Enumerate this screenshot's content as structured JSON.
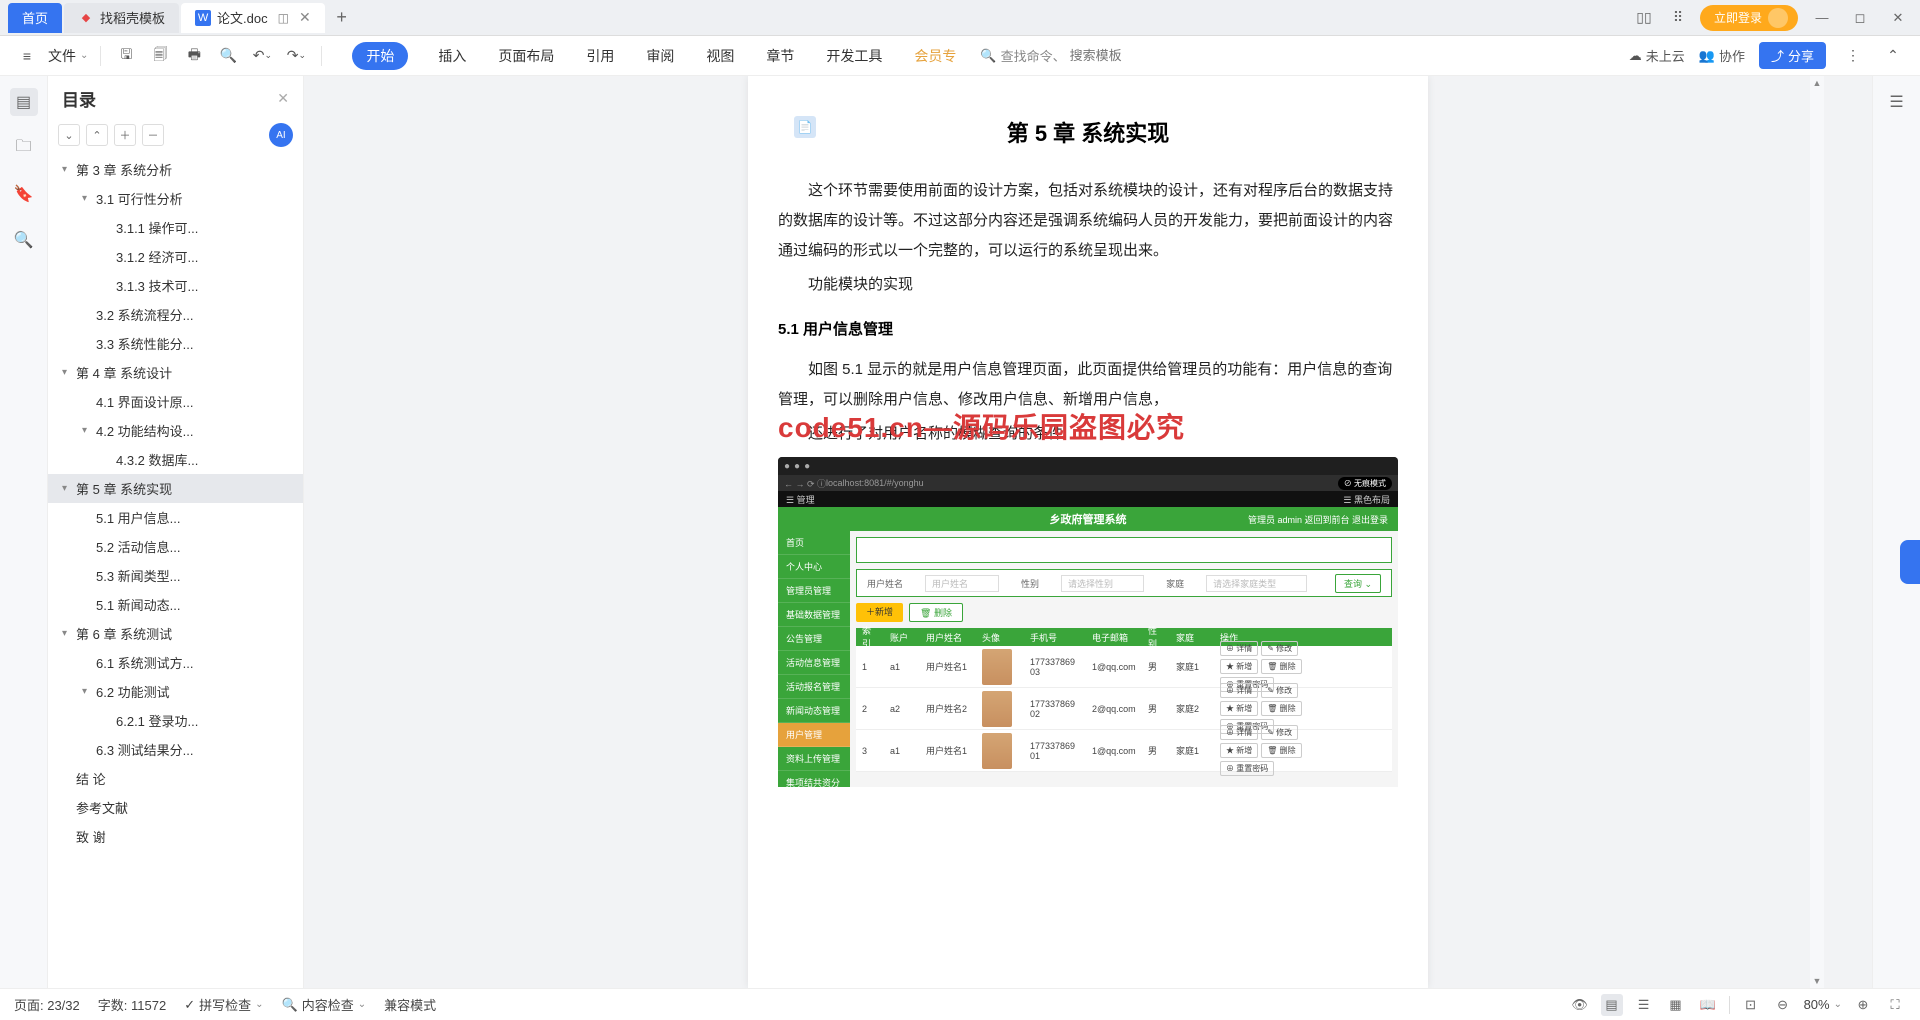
{
  "tabs": {
    "home": "首页",
    "tab1": "找稻壳模板",
    "tab2": "论文.doc",
    "add": "+"
  },
  "titlebar": {
    "login": "立即登录"
  },
  "ribbon": {
    "file": "文件",
    "menus": [
      "开始",
      "插入",
      "页面布局",
      "引用",
      "审阅",
      "视图",
      "章节",
      "开发工具",
      "会员专"
    ],
    "search_prefix": "查找命令、",
    "search_placeholder": "搜索模板",
    "cloud": "未上云",
    "coop": "协作",
    "share": "分享"
  },
  "outline": {
    "title": "目录",
    "items": [
      {
        "lvl": 1,
        "chev": "▾",
        "text": "第 3 章  系统分析"
      },
      {
        "lvl": 2,
        "chev": "▾",
        "text": "3.1 可行性分析"
      },
      {
        "lvl": 3,
        "chev": "",
        "text": "3.1.1 操作可..."
      },
      {
        "lvl": 3,
        "chev": "",
        "text": "3.1.2 经济可..."
      },
      {
        "lvl": 3,
        "chev": "",
        "text": "3.1.3 技术可..."
      },
      {
        "lvl": 2,
        "chev": "",
        "text": "3.2 系统流程分..."
      },
      {
        "lvl": 2,
        "chev": "",
        "text": "3.3 系统性能分..."
      },
      {
        "lvl": 1,
        "chev": "▾",
        "text": "第 4 章  系统设计"
      },
      {
        "lvl": 2,
        "chev": "",
        "text": "4.1 界面设计原..."
      },
      {
        "lvl": 2,
        "chev": "▾",
        "text": "4.2 功能结构设..."
      },
      {
        "lvl": 3,
        "chev": "",
        "text": "4.3.2 数据库..."
      },
      {
        "lvl": 1,
        "chev": "▾",
        "text": "第 5 章  系统实现",
        "sel": true
      },
      {
        "lvl": 2,
        "chev": "",
        "text": "5.1 用户信息..."
      },
      {
        "lvl": 2,
        "chev": "",
        "text": "5.2 活动信息..."
      },
      {
        "lvl": 2,
        "chev": "",
        "text": "5.3 新闻类型..."
      },
      {
        "lvl": 2,
        "chev": "",
        "text": "5.1 新闻动态..."
      },
      {
        "lvl": 1,
        "chev": "▾",
        "text": "第 6 章  系统测试"
      },
      {
        "lvl": 2,
        "chev": "",
        "text": "6.1 系统测试方..."
      },
      {
        "lvl": 2,
        "chev": "▾",
        "text": "6.2 功能测试"
      },
      {
        "lvl": 3,
        "chev": "",
        "text": "6.2.1 登录功..."
      },
      {
        "lvl": 2,
        "chev": "",
        "text": "6.3 测试结果分..."
      },
      {
        "lvl": 1,
        "chev": "",
        "text": "结   论"
      },
      {
        "lvl": 1,
        "chev": "",
        "text": "参考文献"
      },
      {
        "lvl": 1,
        "chev": "",
        "text": "致   谢"
      }
    ]
  },
  "document": {
    "title": "第 5 章  系统实现",
    "p1": "这个环节需要使用前面的设计方案，包括对系统模块的设计，还有对程序后台的数据支持的数据库的设计等。不过这部分内容还是强调系统编码人员的开发能力，要把前面设计的内容通过编码的形式以一个完整的，可以运行的系统呈现出来。",
    "p2": "功能模块的实现",
    "h3": "5.1 用户信息管理",
    "p3": "如图 5.1 显示的就是用户信息管理页面，此页面提供给管理员的功能有：用户信息的查询管理，可以删除用户信息、修改用户信息、新增用户信息，",
    "p4": "还进行了对用户名称的模糊查询的条件",
    "watermark": "code51.cn—源码乐园盗图必究"
  },
  "embed": {
    "url": "localhost:8081/#/yonghu",
    "mode": "⊘ 无痕模式",
    "topbar_left": "☰ 管理",
    "topbar_right": "☰ 黑色布局",
    "title": "乡政府管理系统",
    "header_right": "管理员 admin    返回到前台    退出登录",
    "side": [
      "首页",
      "个人中心",
      "管理员管理",
      "基础数据管理",
      "公告管理",
      "活动信息管理",
      "活动报名管理",
      "新闻动态管理",
      "用户管理",
      "资料上传管理",
      "集项结共资分理"
    ],
    "side_active_index": 8,
    "filter_labels": [
      "用户姓名",
      "性别",
      "家庭"
    ],
    "filter_btn": "查询 ⌄",
    "actions": {
      "add": "＋新增",
      "del": "🗑 删除"
    },
    "thead": [
      "索引",
      "账户",
      "用户姓名",
      "头像",
      "手机号",
      "电子邮箱",
      "性别",
      "家庭",
      "操作"
    ],
    "rows": [
      {
        "idx": "1",
        "acc": "a1",
        "name": "用户姓名1",
        "phone": "177337869 03",
        "email": "1@qq.com",
        "sex": "男",
        "home": "家庭1"
      },
      {
        "idx": "2",
        "acc": "a2",
        "name": "用户姓名2",
        "phone": "177337869 02",
        "email": "2@qq.com",
        "sex": "男",
        "home": "家庭2"
      },
      {
        "idx": "3",
        "acc": "a1",
        "name": "用户姓名1",
        "phone": "177337869 01",
        "email": "1@qq.com",
        "sex": "男",
        "home": "家庭1"
      }
    ],
    "ops": [
      "⊕ 详情",
      "✎ 修改",
      "★ 新增",
      "🗑 删除",
      "⊕ 重置密码"
    ]
  },
  "status": {
    "page": "页面: 23/32",
    "words": "字数: 11572",
    "spell": "拼写检查",
    "content": "内容检查",
    "compat": "兼容模式",
    "zoom": "80%"
  }
}
